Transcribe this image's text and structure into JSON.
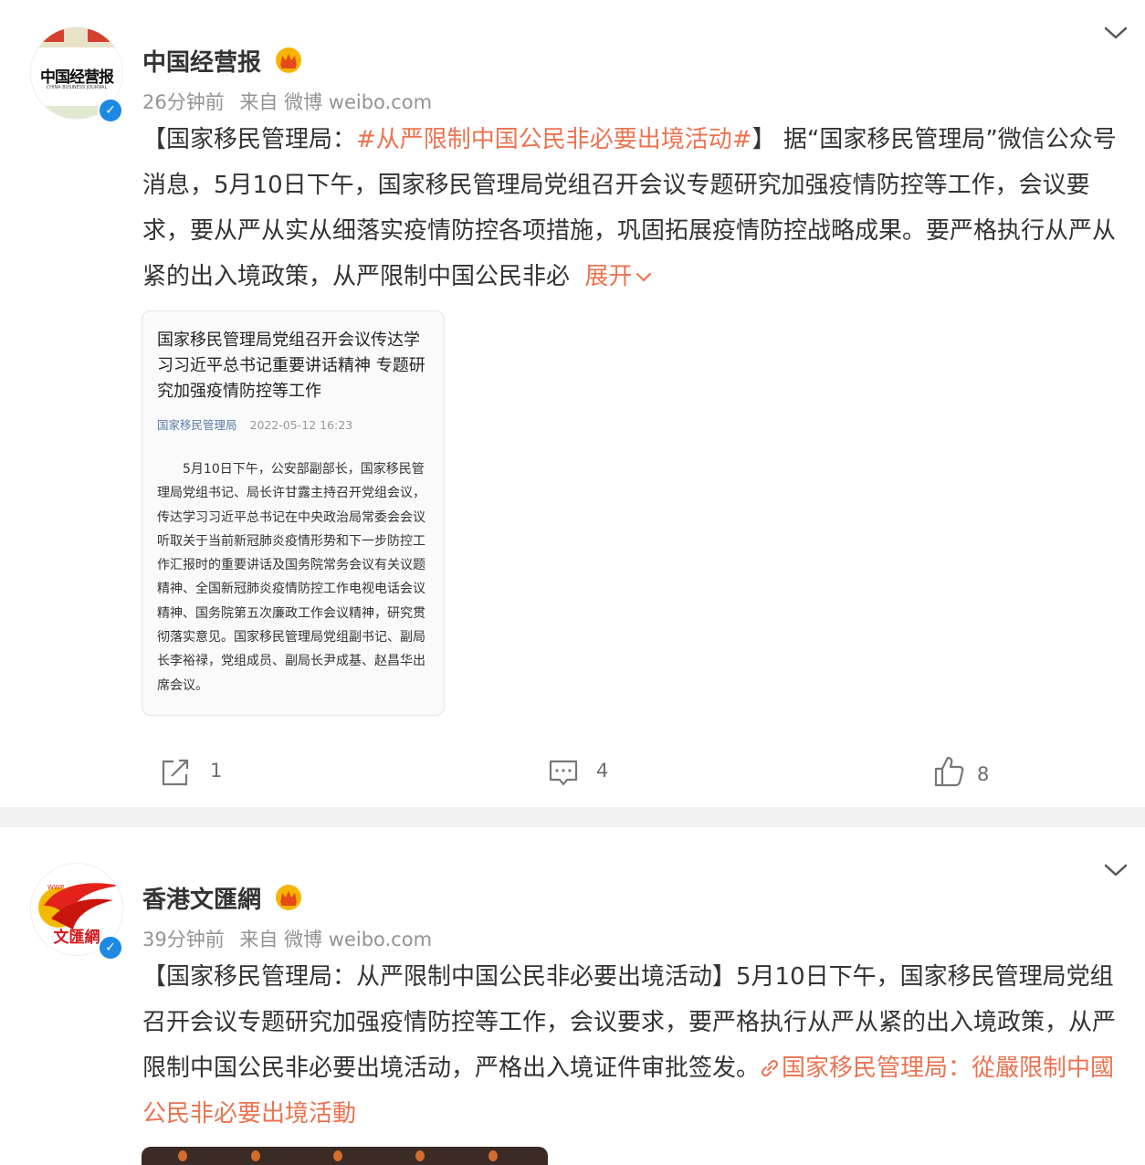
{
  "posts": [
    {
      "author": "中国经营报",
      "avatar_text": "中国经营报",
      "avatar_sub": "CHINA BUSINESS JOURNAL",
      "time": "26分钟前",
      "source": "来自 微博 weibo.com",
      "text_prefix": "【国家移民管理局：",
      "hashtag": "#从严限制中国公民非必要出境活动#",
      "text_body": "】 据“国家移民管理局”微信公众号消息，5月10日下午，国家移民管理局党组召开会议专题研究加强疫情防控等工作，会议要求，要从严从实从细落实疫情防控各项措施，巩固拓展疫情防控战略成果。要严格执行从严从紧的出入境政策，从严限制中国公民非必",
      "expand_label": "展开",
      "card": {
        "title": "国家移民管理局党组召开会议传达学习习近平总书记重要讲话精神 专题研究加强疫情防控等工作",
        "source": "国家移民管理局",
        "date": "2022-05-12 16:23",
        "body": "5月10日下午，公安部副部长，国家移民管理局党组书记、局长许甘露主持召开党组会议，传达学习习近平总书记在中央政治局常委会会议听取关于当前新冠肺炎疫情形势和下一步防控工作汇报时的重要讲话及国务院常务会议有关议题精神、全国新冠肺炎疫情防控工作电视电话会议精神、国务院第五次廉政工作会议精神，研究贯彻落实意见。国家移民管理局党组副书记、副局长李裕禄，党组成员、副局长尹成基、赵昌华出席会议。"
      },
      "actions": {
        "share": "1",
        "comment": "4",
        "like": "8"
      }
    },
    {
      "author": "香港文匯網",
      "avatar_text": "文匯網",
      "time": "39分钟前",
      "source": "来自 微博 weibo.com",
      "text_body": "【国家移民管理局：从严限制中国公民非必要出境活动】5月10日下午，国家移民管理局党组召开会议专题研究加强疫情防控等工作，会议要求，要严格执行从严从紧的出入境政策，从严限制中国公民非必要出境活动，严格出入境证件审批签发。",
      "link_text": "国家移民管理局：從嚴限制中國公民非必要出境活動"
    }
  ],
  "colors": {
    "accent": "#eb7350",
    "verified": "#1e88e5",
    "separator": "#f2f2f2"
  },
  "icons": [
    "chevron-down-icon",
    "crown-badge-icon",
    "verified-icon",
    "share-icon",
    "comment-icon",
    "like-icon",
    "link-icon"
  ]
}
